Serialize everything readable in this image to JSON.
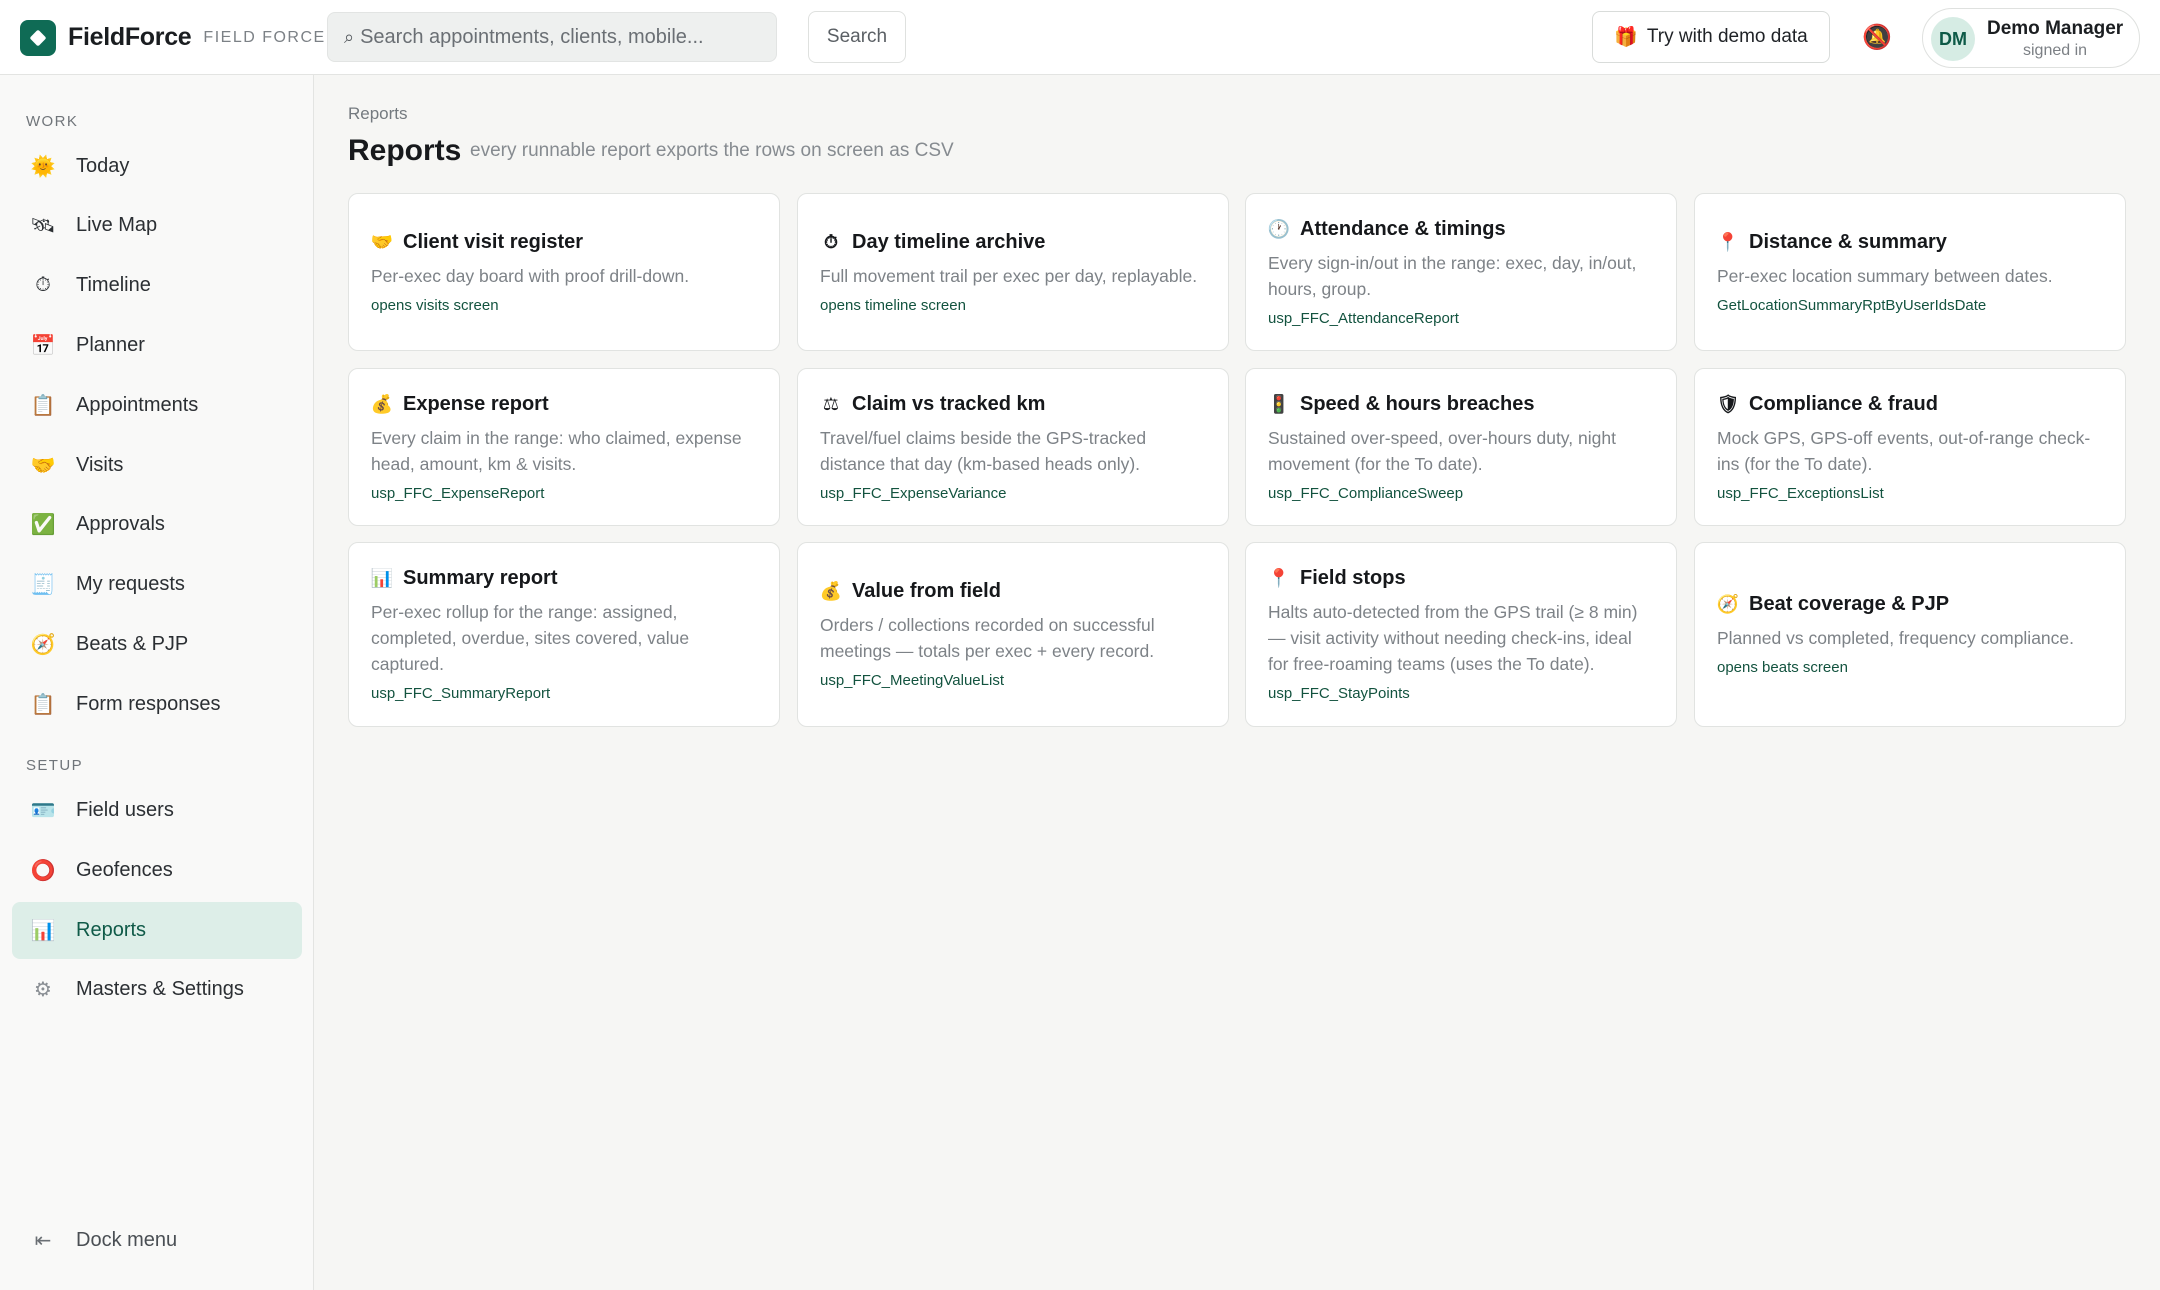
{
  "app": {
    "name": "FieldForce",
    "tag": "FIELD FORCE"
  },
  "topbar": {
    "search_placeholder": "Search appointments, clients, mobile...",
    "search_button": "Search",
    "demo_button": "Try with demo data",
    "demo_icon": "gift-icon",
    "bell_icon": "bell-muted-icon",
    "user": {
      "initials": "DM",
      "name": "Demo Manager",
      "status": "signed in"
    }
  },
  "sidebar": {
    "work_title": "WORK",
    "setup_title": "SETUP",
    "work_items": [
      {
        "label": "Today",
        "icon": "🌞"
      },
      {
        "label": "Live Map",
        "icon": "🛰"
      },
      {
        "label": "Timeline",
        "icon": "⏱"
      },
      {
        "label": "Planner",
        "icon": "📅"
      },
      {
        "label": "Appointments",
        "icon": "📋"
      },
      {
        "label": "Visits",
        "icon": "🤝"
      },
      {
        "label": "Approvals",
        "icon": "✅"
      },
      {
        "label": "My requests",
        "icon": "🧾"
      },
      {
        "label": "Beats & PJP",
        "icon": "🧭"
      },
      {
        "label": "Form responses",
        "icon": "📋"
      }
    ],
    "setup_items": [
      {
        "label": "Field users",
        "icon": "🪪"
      },
      {
        "label": "Geofences",
        "icon": "⭕"
      },
      {
        "label": "Reports",
        "icon": "📊",
        "active": true
      },
      {
        "label": "Masters & Settings",
        "icon": "⚙"
      }
    ],
    "dock_label": "Dock menu",
    "dock_icon": "⇤"
  },
  "main": {
    "breadcrumb": "Reports",
    "title": "Reports",
    "subtitle": "every runnable report exports the rows on screen as CSV",
    "cards": [
      {
        "icon": "🤝",
        "title": "Client visit register",
        "desc": "Per-exec day board with proof drill-down.",
        "code": "opens visits screen"
      },
      {
        "icon": "⏱",
        "title": "Day timeline archive",
        "desc": "Full movement trail per exec per day, replayable.",
        "code": "opens timeline screen"
      },
      {
        "icon": "🕐",
        "title": "Attendance & timings",
        "desc": "Every sign-in/out in the range: exec, day, in/out, hours, group.",
        "code": "usp_FFC_AttendanceReport"
      },
      {
        "icon": "📍",
        "title": "Distance & summary",
        "desc": "Per-exec location summary between dates.",
        "code": "GetLocationSummaryRptByUserIdsDate"
      },
      {
        "icon": "💰",
        "title": "Expense report",
        "desc": "Every claim in the range: who claimed, expense head, amount, km & visits.",
        "code": "usp_FFC_ExpenseReport"
      },
      {
        "icon": "⚖",
        "title": "Claim vs tracked km",
        "desc": "Travel/fuel claims beside the GPS-tracked distance that day (km-based heads only).",
        "code": "usp_FFC_ExpenseVariance"
      },
      {
        "icon": "🚦",
        "title": "Speed & hours breaches",
        "desc": "Sustained over-speed, over-hours duty, night movement (for the To date).",
        "code": "usp_FFC_ComplianceSweep"
      },
      {
        "icon": "🛡",
        "title": "Compliance & fraud",
        "desc": "Mock GPS, GPS-off events, out-of-range check-ins (for the To date).",
        "code": "usp_FFC_ExceptionsList"
      },
      {
        "icon": "📊",
        "title": "Summary report",
        "desc": "Per-exec rollup for the range: assigned, completed, overdue, sites covered, value captured.",
        "code": "usp_FFC_SummaryReport"
      },
      {
        "icon": "💰",
        "title": "Value from field",
        "desc": "Orders / collections recorded on successful meetings — totals per exec + every record.",
        "code": "usp_FFC_MeetingValueList"
      },
      {
        "icon": "📍",
        "title": "Field stops",
        "desc": "Halts auto-detected from the GPS trail (≥ 8 min) — visit activity without needing check-ins, ideal for free-roaming teams (uses the To date).",
        "code": "usp_FFC_StayPoints"
      },
      {
        "icon": "🧭",
        "title": "Beat coverage & PJP",
        "desc": "Planned vs completed, frequency compliance.",
        "code": "opens beats screen"
      }
    ]
  },
  "colors": {
    "accent": "#0f6b55",
    "active_nav_bg": "#ddeee8",
    "code_text": "#13533f"
  }
}
